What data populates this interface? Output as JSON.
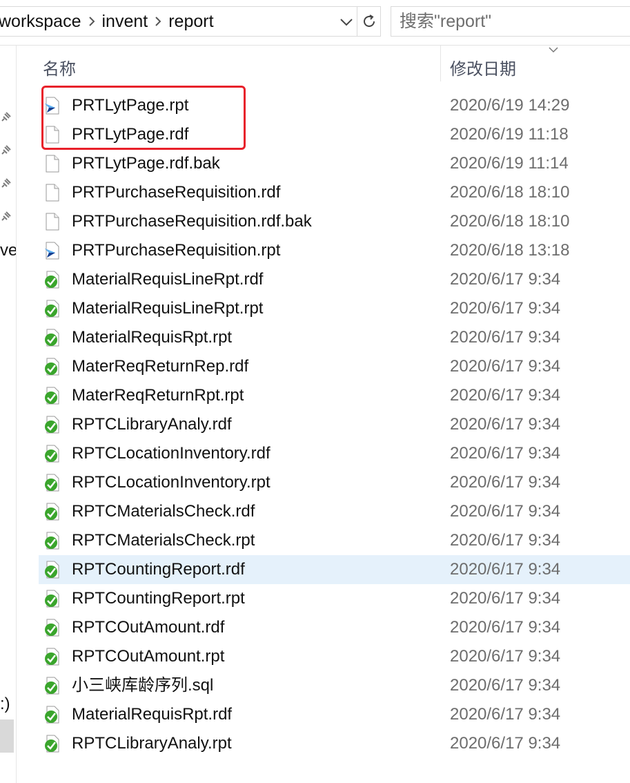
{
  "address_bar": {
    "crumbs": [
      "workspace",
      "invent",
      "report"
    ]
  },
  "search": {
    "placeholder": "搜索\"report\""
  },
  "nav": {
    "partial_texts": [
      "ve",
      ":)"
    ]
  },
  "columns": {
    "name": "名称",
    "date_modified": "修改日期"
  },
  "files": [
    {
      "name": "PRTLytPage.rpt",
      "date": "2020/6/19 14:29",
      "icon": "rpt-arrow-icon"
    },
    {
      "name": "PRTLytPage.rdf",
      "date": "2020/6/19 11:18",
      "icon": "blank-file-icon"
    },
    {
      "name": "PRTLytPage.rdf.bak",
      "date": "2020/6/19 11:14",
      "icon": "blank-file-icon"
    },
    {
      "name": "PRTPurchaseRequisition.rdf",
      "date": "2020/6/18 18:10",
      "icon": "blank-file-icon"
    },
    {
      "name": "PRTPurchaseRequisition.rdf.bak",
      "date": "2020/6/18 18:10",
      "icon": "blank-file-icon"
    },
    {
      "name": "PRTPurchaseRequisition.rpt",
      "date": "2020/6/18 13:18",
      "icon": "rpt-arrow-icon"
    },
    {
      "name": "MaterialRequisLineRpt.rdf",
      "date": "2020/6/17 9:34",
      "icon": "green-check-file-icon"
    },
    {
      "name": "MaterialRequisLineRpt.rpt",
      "date": "2020/6/17 9:34",
      "icon": "green-check-file-icon"
    },
    {
      "name": "MaterialRequisRpt.rpt",
      "date": "2020/6/17 9:34",
      "icon": "green-check-file-icon"
    },
    {
      "name": "MaterReqReturnRep.rdf",
      "date": "2020/6/17 9:34",
      "icon": "green-check-file-icon"
    },
    {
      "name": "MaterReqReturnRpt.rpt",
      "date": "2020/6/17 9:34",
      "icon": "green-check-file-icon"
    },
    {
      "name": "RPTCLibraryAnaly.rdf",
      "date": "2020/6/17 9:34",
      "icon": "green-check-file-icon"
    },
    {
      "name": "RPTCLocationInventory.rdf",
      "date": "2020/6/17 9:34",
      "icon": "green-check-file-icon"
    },
    {
      "name": "RPTCLocationInventory.rpt",
      "date": "2020/6/17 9:34",
      "icon": "green-check-file-icon"
    },
    {
      "name": "RPTCMaterialsCheck.rdf",
      "date": "2020/6/17 9:34",
      "icon": "green-check-file-icon"
    },
    {
      "name": "RPTCMaterialsCheck.rpt",
      "date": "2020/6/17 9:34",
      "icon": "green-check-file-icon"
    },
    {
      "name": "RPTCountingReport.rdf",
      "date": "2020/6/17 9:34",
      "icon": "green-check-file-icon",
      "selected": true
    },
    {
      "name": "RPTCountingReport.rpt",
      "date": "2020/6/17 9:34",
      "icon": "green-check-file-icon"
    },
    {
      "name": "RPTCOutAmount.rdf",
      "date": "2020/6/17 9:34",
      "icon": "green-check-file-icon"
    },
    {
      "name": "RPTCOutAmount.rpt",
      "date": "2020/6/17 9:34",
      "icon": "green-check-file-icon"
    },
    {
      "name": "小三峡库龄序列.sql",
      "date": "2020/6/17 9:34",
      "icon": "green-check-file-icon"
    },
    {
      "name": "MaterialRequisRpt.rdf",
      "date": "2020/6/17 9:34",
      "icon": "green-check-file-icon"
    },
    {
      "name": "RPTCLibraryAnaly.rpt",
      "date": "2020/6/17 9:34",
      "icon": "green-check-file-icon"
    }
  ],
  "colors": {
    "selection_bg": "#e5f1fb",
    "highlight_border": "#e8202a",
    "date_text": "#6d6d6d",
    "header_text": "#4a5060"
  }
}
